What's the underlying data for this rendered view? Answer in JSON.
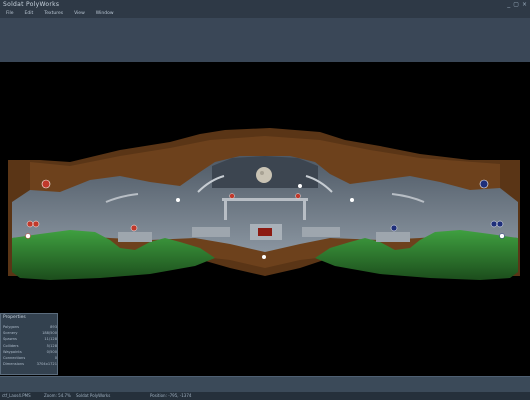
{
  "window": {
    "title": "Soldat PolyWorks",
    "controls": [
      "_",
      "▢",
      "×"
    ]
  },
  "menu": [
    "File",
    "Edit",
    "Textures",
    "View",
    "Window"
  ],
  "properties": {
    "title": "Properties",
    "rows": [
      {
        "label": "Polygons",
        "value": "893"
      },
      {
        "label": "Scenery",
        "value": "188/500"
      },
      {
        "label": "Spawns",
        "value": "11/128"
      },
      {
        "label": "Colliders",
        "value": "5/128"
      },
      {
        "label": "Waypoints",
        "value": "0/500"
      },
      {
        "label": "Connections",
        "value": "0"
      },
      {
        "label": "Dimensions",
        "value": "3704x1721"
      }
    ]
  },
  "status": {
    "file": "ctf_Laos4.PMS",
    "zoom": "Zoom: 54.7%",
    "tool": "Soldat PolyWorks",
    "position": "Position: -795, -1374"
  },
  "colors": {
    "chrome": "#2e3946",
    "toolbar": "#3a4757",
    "grass": "#2f8a2e",
    "dirt": "#6a3e1a",
    "cave": "#7c8794",
    "platform": "#9aa3ac",
    "red_team": "#c0392b",
    "blue_team": "#1f2f7a"
  }
}
